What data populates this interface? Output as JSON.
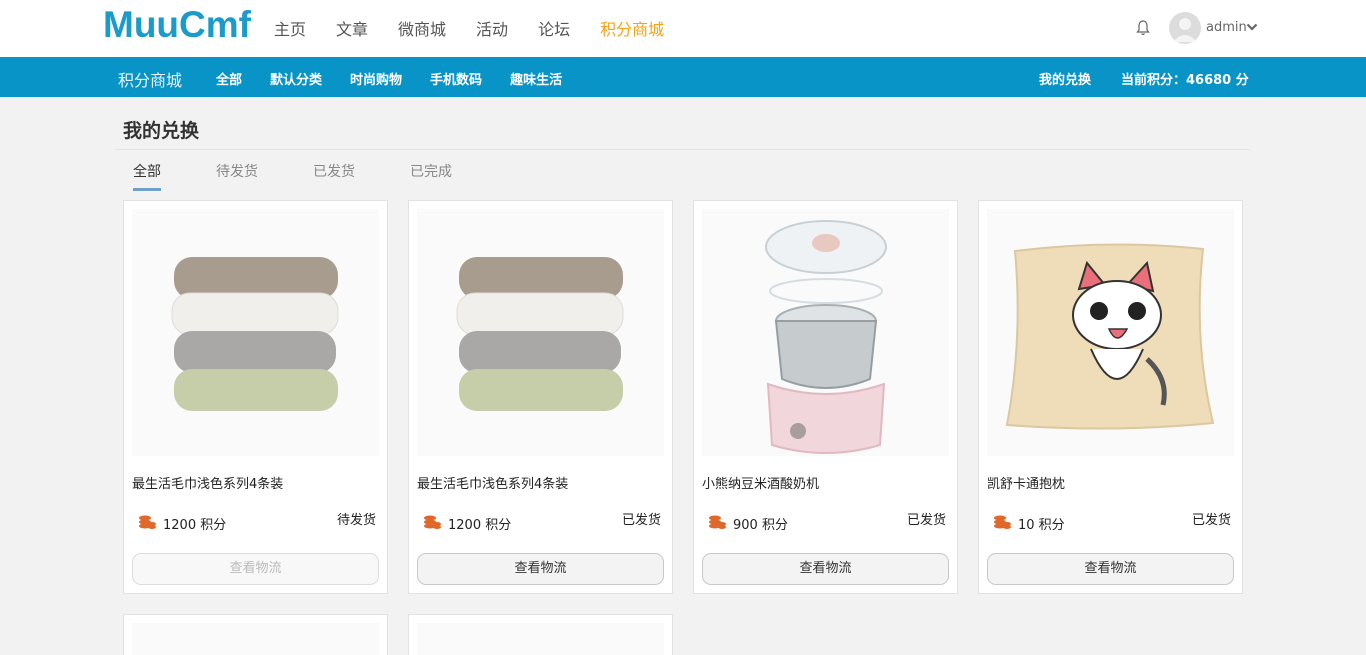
{
  "logo": "MuuCmf",
  "main_nav": [
    {
      "label": "主页",
      "active": false
    },
    {
      "label": "文章",
      "active": false
    },
    {
      "label": "微商城",
      "active": false
    },
    {
      "label": "活动",
      "active": false
    },
    {
      "label": "论坛",
      "active": false
    },
    {
      "label": "积分商城",
      "active": true
    }
  ],
  "user": {
    "name": "admin"
  },
  "sub_nav": {
    "brand": "积分商城",
    "items": [
      "全部",
      "默认分类",
      "时尚购物",
      "手机数码",
      "趣味生活"
    ],
    "my_exchange": "我的兑换",
    "current_points": "当前积分：46680 分"
  },
  "page_title": "我的兑换",
  "tabs": [
    {
      "label": "全部",
      "active": true
    },
    {
      "label": "待发货",
      "active": false
    },
    {
      "label": "已发货",
      "active": false
    },
    {
      "label": "已完成",
      "active": false
    }
  ],
  "orders": [
    {
      "name": "最生活毛巾浅色系列4条装",
      "points": "1200 积分",
      "status": "待发货",
      "button": "查看物流",
      "button_disabled": true,
      "image": "towels"
    },
    {
      "name": "最生活毛巾浅色系列4条装",
      "points": "1200 积分",
      "status": "已发货",
      "button": "查看物流",
      "button_disabled": false,
      "image": "towels"
    },
    {
      "name": "小熊纳豆米酒酸奶机",
      "points": "900 积分",
      "status": "已发货",
      "button": "查看物流",
      "button_disabled": false,
      "image": "yogurt-maker"
    },
    {
      "name": "凯舒卡通抱枕",
      "points": "10 积分",
      "status": "已发货",
      "button": "查看物流",
      "button_disabled": false,
      "image": "cat-pillow"
    }
  ],
  "colors": {
    "brand_blue": "#0994c7",
    "logo_blue": "#1b9bc9",
    "active_orange": "#f5a31a",
    "coin": "#e0682a"
  }
}
